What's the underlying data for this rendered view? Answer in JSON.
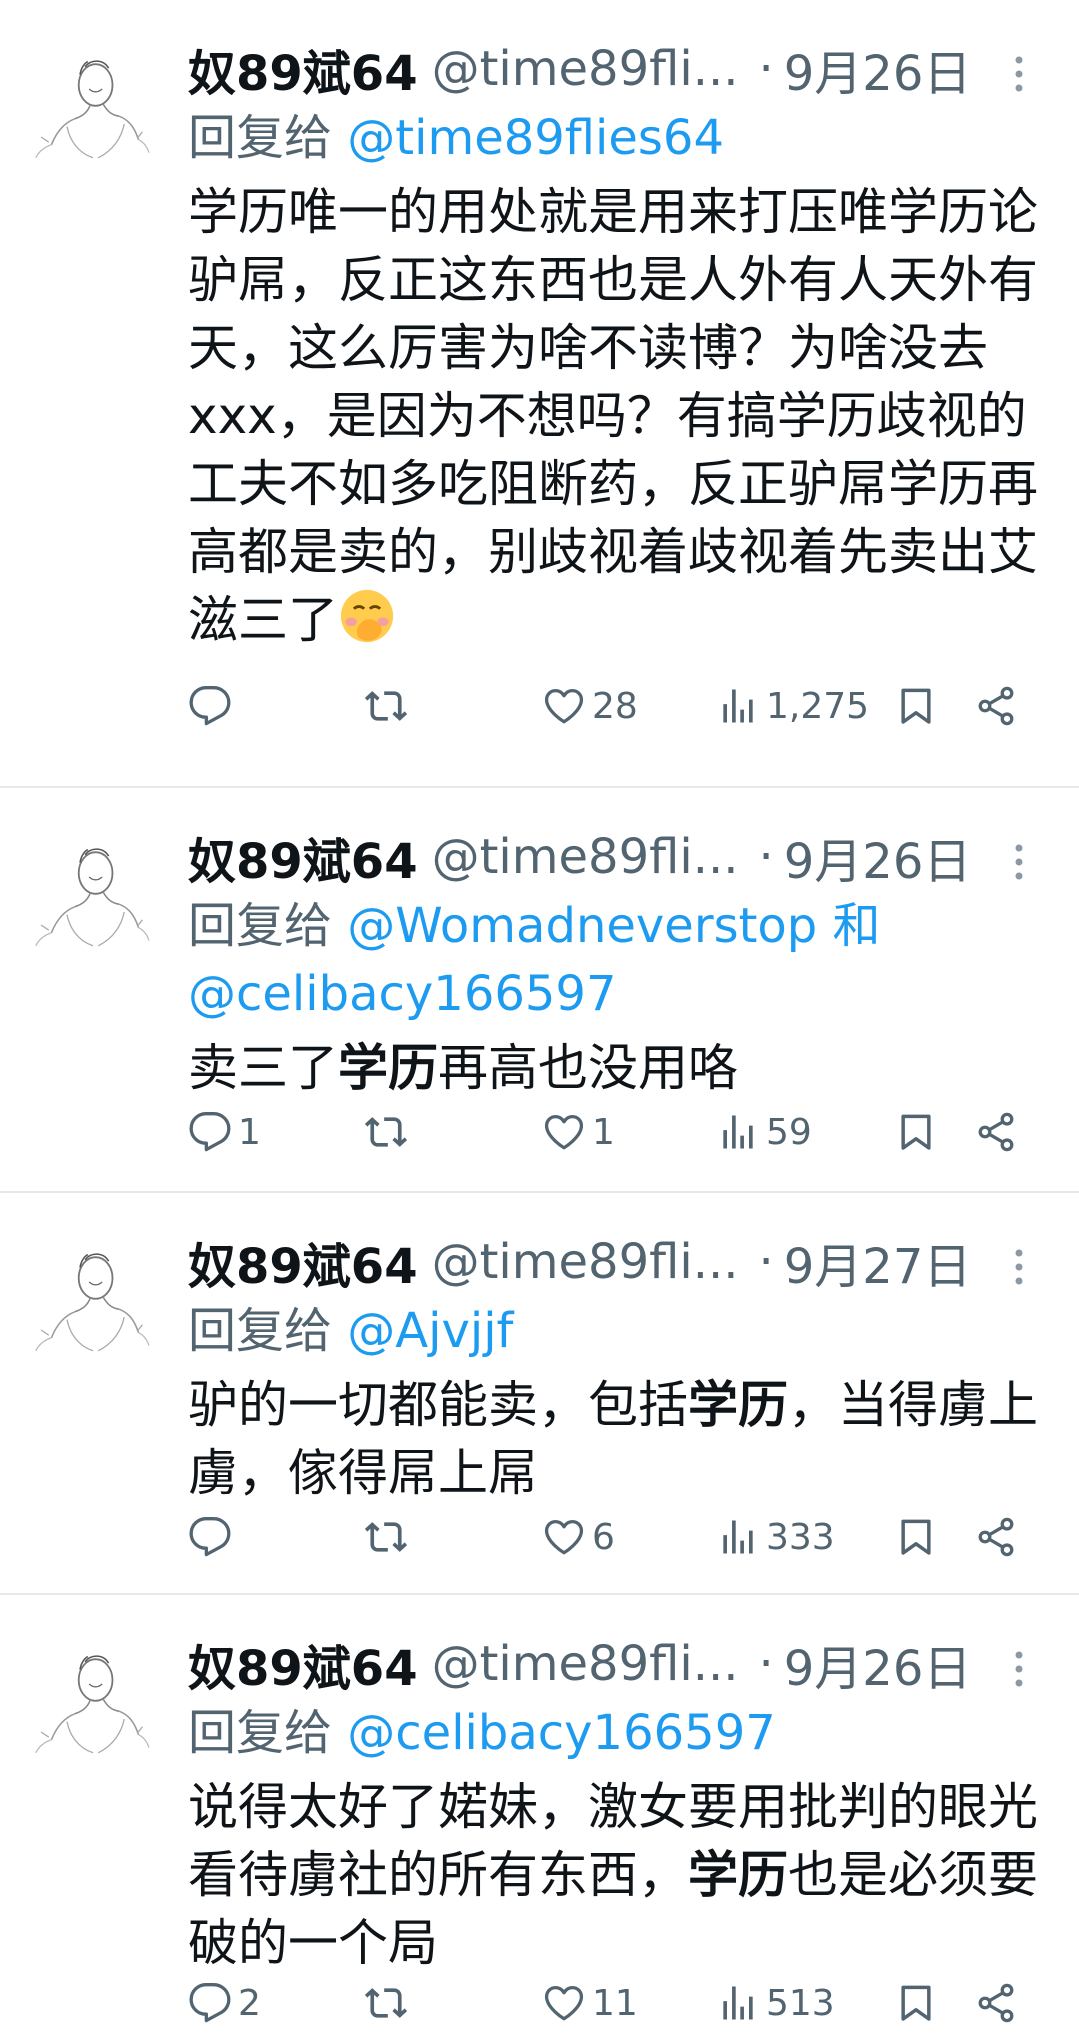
{
  "tweets": [
    {
      "name": "奴89斌64",
      "handle": "@time89fli...",
      "dot": "·",
      "date": "9月26日",
      "reply_prefix": "回复给",
      "reply_mention": "@time89flies64",
      "reply_mention_2": "",
      "reply_joiner": "",
      "text_1": "学历唯一的用处就是用来打压唯学历论驴屌，反正这东西也是人外有人天外有天，这么厉害为啥不读博？为啥没去xxx，是因为不想吗？有搞学历歧视的工夫不如多吃阻断药，反正驴屌学历再高都是卖的，别歧视着歧视着先卖出艾滋三了",
      "replies": "",
      "retweets": "",
      "likes": "28",
      "views": "1,275"
    },
    {
      "name": "奴89斌64",
      "handle": "@time89fli...",
      "dot": "·",
      "date": "9月26日",
      "reply_prefix": "回复给",
      "reply_mention": "@Womadneverstop",
      "reply_joiner": "和",
      "reply_mention_2": "@celibacy166597",
      "text_a": "卖三了",
      "text_bold": "学历",
      "text_b": "再高也没用咯",
      "replies": "1",
      "retweets": "",
      "likes": "1",
      "views": "59"
    },
    {
      "name": "奴89斌64",
      "handle": "@time89fli...",
      "dot": "·",
      "date": "9月27日",
      "reply_prefix": "回复给",
      "reply_mention": "@Ajvjjf",
      "text_a": "驴的一切都能卖，包括",
      "text_bold": "学历",
      "text_b": "，当得虜上虜，傢得屌上屌",
      "replies": "",
      "retweets": "",
      "likes": "6",
      "views": "333"
    },
    {
      "name": "奴89斌64",
      "handle": "@time89fli...",
      "dot": "·",
      "date": "9月26日",
      "reply_prefix": "回复给",
      "reply_mention": "@celibacy166597",
      "text_a": "说得太好了婼妹，激女要用批判的眼光看待虜社的所有东西，",
      "text_bold": "学历",
      "text_b": "也是必须要破的一个局",
      "replies": "2",
      "retweets": "",
      "likes": "11",
      "views": "513"
    }
  ],
  "icons": {
    "reply": "reply-icon",
    "retweet": "retweet-icon",
    "like": "heart-icon",
    "views": "views-icon",
    "bookmark": "bookmark-icon",
    "share": "share-icon",
    "more": "more-vertical-icon",
    "emoji": "face-with-hand-over-mouth-emoji"
  },
  "colors": {
    "accent": "#1d9bf0",
    "secondary": "#536471",
    "text": "#0f1419"
  }
}
